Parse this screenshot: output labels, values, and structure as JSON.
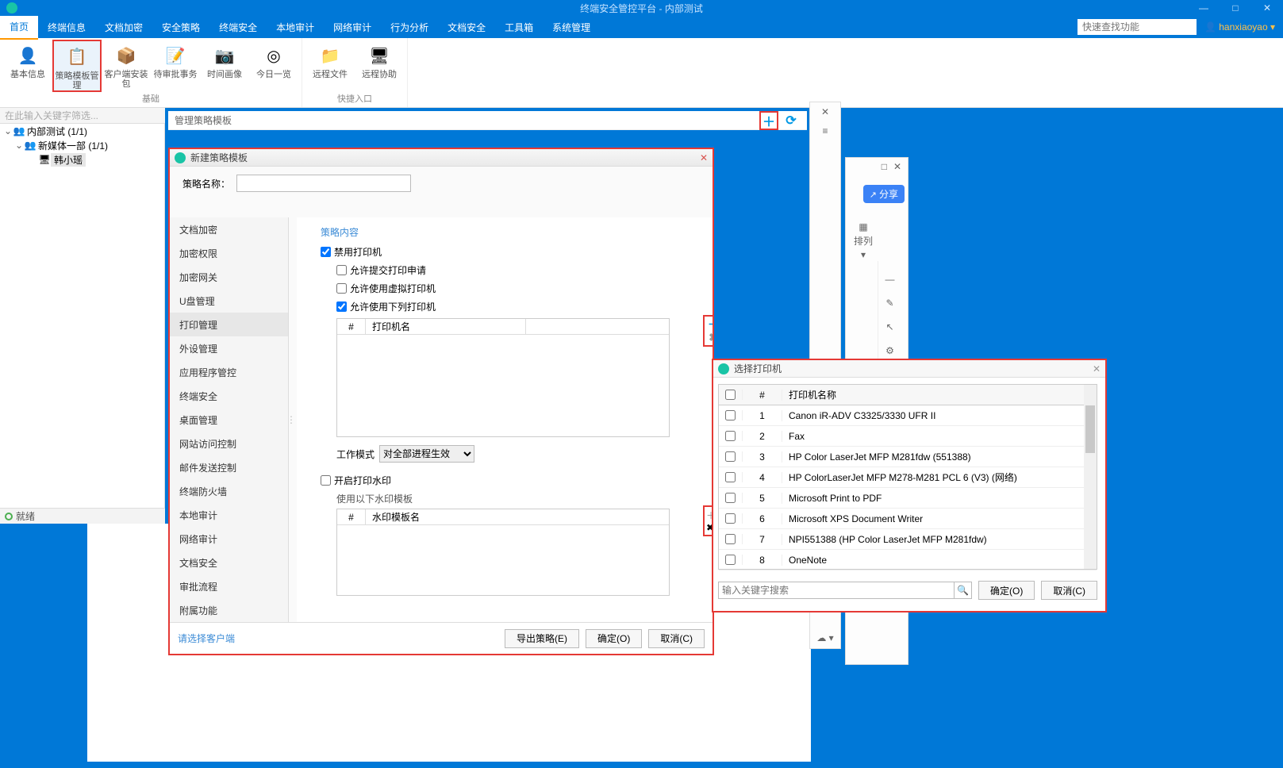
{
  "titlebar": {
    "title": "终端安全管控平台 - 内部测试"
  },
  "menubar": {
    "tabs": [
      "首页",
      "终端信息",
      "文档加密",
      "安全策略",
      "终端安全",
      "本地审计",
      "网络审计",
      "行为分析",
      "文档安全",
      "工具箱",
      "系统管理"
    ],
    "search_placeholder": "快速查找功能",
    "user": "hanxiaoyao"
  },
  "ribbon": {
    "group1_label": "基础",
    "group1": [
      "基本信息",
      "策略模板管理",
      "客户端安装包",
      "待审批事务",
      "时间画像",
      "今日一览"
    ],
    "group2_label": "快捷入口",
    "group2": [
      "远程文件",
      "远程协助"
    ]
  },
  "filter_placeholder": "在此输入关键字筛选...",
  "tree": {
    "root": "内部测试 (1/1)",
    "child1": "新媒体一部 (1/1)",
    "leaf": "韩小瑶"
  },
  "statusbar": {
    "text": "就绪"
  },
  "main_header": {
    "title": "管理策略模板"
  },
  "dlg": {
    "title": "新建策略模板",
    "name_label": "策略名称：",
    "side": [
      "文档加密",
      "加密权限",
      "加密网关",
      "U盘管理",
      "打印管理",
      "外设管理",
      "应用程序管控",
      "终端安全",
      "桌面管理",
      "网站访问控制",
      "邮件发送控制",
      "终端防火墙",
      "本地审计",
      "网络审计",
      "文档安全",
      "审批流程",
      "附属功能"
    ],
    "sect": "策略内容",
    "chk_disable": "禁用打印机",
    "chk_submit": "允许提交打印申请",
    "chk_virtual": "允许使用虚拟打印机",
    "chk_allow_list": "允许使用下列打印机",
    "printer_h1": "#",
    "printer_h2": "打印机名",
    "workmode_label": "工作模式",
    "workmode_value": "对全部进程生效",
    "chk_watermark": "开启打印水印",
    "watermark_hint": "使用以下水印模板",
    "wm_h1": "#",
    "wm_h2": "水印模板名",
    "footer_hint": "请选择客户端",
    "btn_export": "导出策略(E)",
    "btn_ok": "确定(O)",
    "btn_cancel": "取消(C)"
  },
  "side_panel": {
    "share": "分享",
    "arrange": "排列"
  },
  "psel": {
    "title": "选择打印机",
    "h_num": "#",
    "h_name": "打印机名称",
    "rows": [
      {
        "n": "1",
        "name": "Canon iR-ADV C3325/3330 UFR II"
      },
      {
        "n": "2",
        "name": "Fax"
      },
      {
        "n": "3",
        "name": "HP Color LaserJet MFP M281fdw (551388)"
      },
      {
        "n": "4",
        "name": "HP ColorLaserJet MFP M278-M281 PCL 6 (V3) (网络)"
      },
      {
        "n": "5",
        "name": "Microsoft Print to PDF"
      },
      {
        "n": "6",
        "name": "Microsoft XPS Document Writer"
      },
      {
        "n": "7",
        "name": "NPI551388 (HP Color LaserJet MFP M281fdw)"
      },
      {
        "n": "8",
        "name": "OneNote"
      }
    ],
    "search_ph": "输入关键字搜索",
    "ok": "确定(O)",
    "cancel": "取消(C)"
  }
}
